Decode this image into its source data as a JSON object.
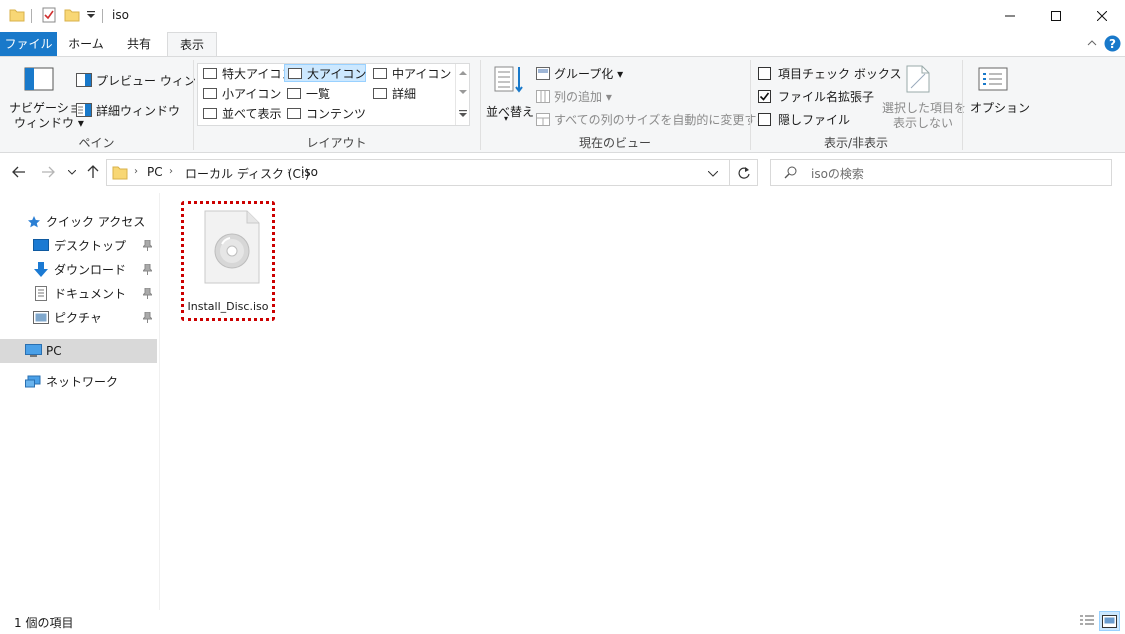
{
  "window": {
    "title": "iso"
  },
  "tabs": [
    {
      "label": "ファイル"
    },
    {
      "label": "ホーム"
    },
    {
      "label": "共有"
    },
    {
      "label": "表示"
    }
  ],
  "ribbon": {
    "pane": {
      "nav_pane_line1": "ナビゲーション",
      "nav_pane_line2": "ウィンドウ",
      "preview": "プレビュー ウィンドウ",
      "details": "詳細ウィンドウ",
      "group_label": "ペイン"
    },
    "layout": {
      "items": [
        {
          "label": "特大アイコン"
        },
        {
          "label": "大アイコン"
        },
        {
          "label": "中アイコン"
        },
        {
          "label": "小アイコン"
        },
        {
          "label": "一覧"
        },
        {
          "label": "詳細"
        },
        {
          "label": "並べて表示"
        },
        {
          "label": "コンテンツ"
        }
      ],
      "selected": "大アイコン",
      "group_label": "レイアウト"
    },
    "current_view": {
      "sort": "並べ替え",
      "group_by": "グループ化",
      "add_columns": "列の追加",
      "autofit": "すべての列のサイズを自動的に変更する",
      "group_label": "現在のビュー"
    },
    "show_hide": {
      "item_checkboxes": "項目チェック ボックス",
      "item_checkboxes_checked": false,
      "file_extensions": "ファイル名拡張子",
      "file_extensions_checked": true,
      "hidden_items": "隠しファイル",
      "hidden_items_checked": false,
      "hide_selected_line1": "選択した項目を",
      "hide_selected_line2": "表示しない",
      "group_label": "表示/非表示"
    },
    "options": "オプション"
  },
  "address": {
    "crumbs": [
      "PC",
      "ローカル ディスク (C:)",
      "iso"
    ],
    "search_placeholder": "isoの検索"
  },
  "nav_pane": {
    "quick_access": "クイック アクセス",
    "items": [
      {
        "label": "デスクトップ"
      },
      {
        "label": "ダウンロード"
      },
      {
        "label": "ドキュメント"
      },
      {
        "label": "ピクチャ"
      }
    ],
    "pc": "PC",
    "network": "ネットワーク"
  },
  "files": [
    {
      "name": "Install_Disc.iso"
    }
  ],
  "status": {
    "count": "1 個の項目"
  },
  "colors": {
    "accent": "#1979ca",
    "highlight": "#cc0000",
    "selection": "#cce8ff"
  }
}
